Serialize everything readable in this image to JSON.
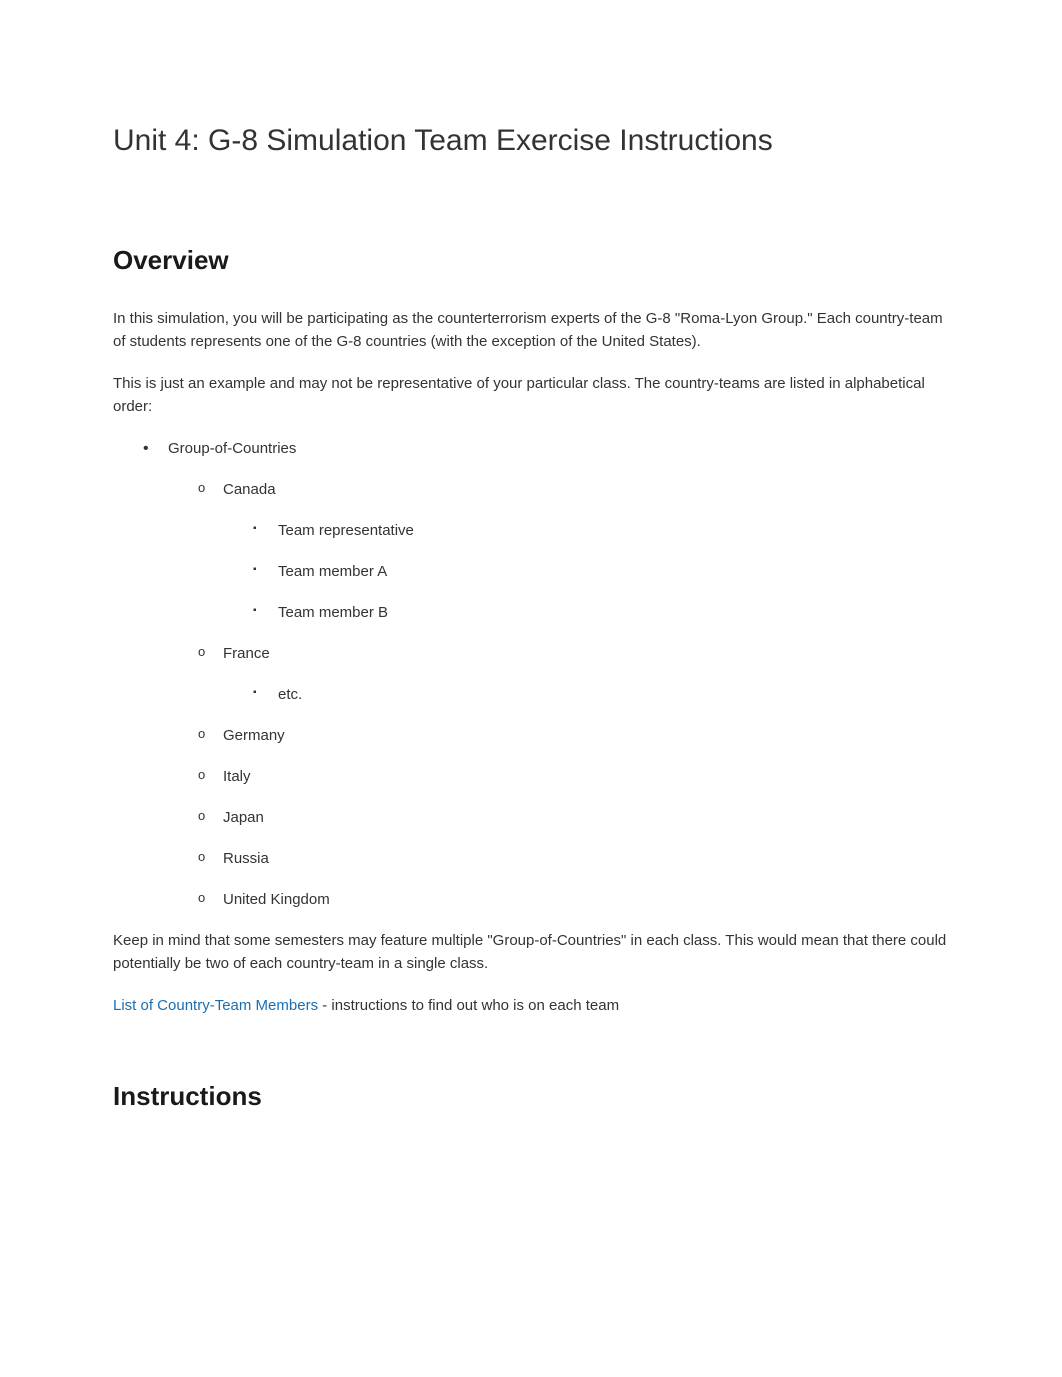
{
  "title": "Unit 4: G-8 Simulation Team Exercise Instructions",
  "overview": {
    "heading": "Overview",
    "p1": "In this simulation, you will be participating as the counterterrorism experts of the G-8 \"Roma-Lyon Group.\" Each country-team of students represents one of the G-8 countries (with the exception of the United States).",
    "p2": "This is just an example and may not be representative of your particular class. The country-teams are listed in alphabetical order:",
    "group_label": "Group-of-Countries",
    "countries": {
      "canada": {
        "name": "Canada",
        "members": {
          "rep": "Team representative",
          "a": "Team member A",
          "b": "Team member B"
        }
      },
      "france": {
        "name": "France",
        "etc": "etc."
      },
      "germany": "Germany",
      "italy": "Italy",
      "japan": "Japan",
      "russia": "Russia",
      "uk": "United Kingdom"
    },
    "p3": "Keep in mind that some semesters may feature multiple \"Group-of-Countries\" in each class. This would mean that there could potentially be two of each country-team in a single class.",
    "link_text": "List of Country-Team Members",
    "link_suffix": " - instructions to find out who is on each team"
  },
  "instructions": {
    "heading": "Instructions"
  }
}
